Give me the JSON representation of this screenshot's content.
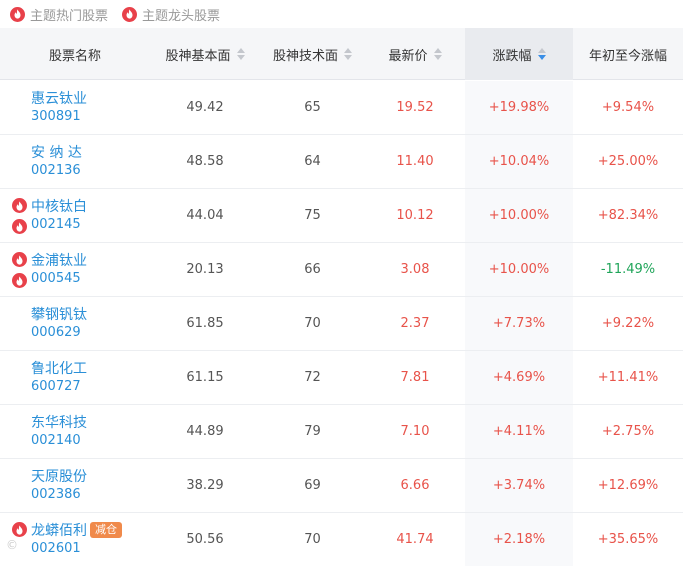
{
  "legend": [
    {
      "label": "主题热门股票"
    },
    {
      "label": "主题龙头股票"
    }
  ],
  "columns": {
    "name": "股票名称",
    "fundamental": "股神基本面",
    "technical": "股神技术面",
    "price": "最新价",
    "change": "涨跌幅",
    "ytd": "年初至今涨幅"
  },
  "sort": {
    "column": "change",
    "direction": "desc"
  },
  "rows": [
    {
      "name": "惠云钛业",
      "code": "300891",
      "fundamental": "49.42",
      "technical": "65",
      "price": "19.52",
      "change": "+19.98%",
      "ytd": "+9.54%",
      "badges": [],
      "tag": ""
    },
    {
      "name": "安 纳 达",
      "code": "002136",
      "fundamental": "48.58",
      "technical": "64",
      "price": "11.40",
      "change": "+10.04%",
      "ytd": "+25.00%",
      "badges": [],
      "tag": ""
    },
    {
      "name": "中核钛白",
      "code": "002145",
      "fundamental": "44.04",
      "technical": "75",
      "price": "10.12",
      "change": "+10.00%",
      "ytd": "+82.34%",
      "badges": [
        "hot",
        "leader"
      ],
      "tag": ""
    },
    {
      "name": "金浦钛业",
      "code": "000545",
      "fundamental": "20.13",
      "technical": "66",
      "price": "3.08",
      "change": "+10.00%",
      "ytd": "-11.49%",
      "badges": [
        "hot",
        "leader"
      ],
      "tag": ""
    },
    {
      "name": "攀钢钒钛",
      "code": "000629",
      "fundamental": "61.85",
      "technical": "70",
      "price": "2.37",
      "change": "+7.73%",
      "ytd": "+9.22%",
      "badges": [],
      "tag": ""
    },
    {
      "name": "鲁北化工",
      "code": "600727",
      "fundamental": "61.15",
      "technical": "72",
      "price": "7.81",
      "change": "+4.69%",
      "ytd": "+11.41%",
      "badges": [],
      "tag": ""
    },
    {
      "name": "东华科技",
      "code": "002140",
      "fundamental": "44.89",
      "technical": "79",
      "price": "7.10",
      "change": "+4.11%",
      "ytd": "+2.75%",
      "badges": [],
      "tag": ""
    },
    {
      "name": "天原股份",
      "code": "002386",
      "fundamental": "38.29",
      "technical": "69",
      "price": "6.66",
      "change": "+3.74%",
      "ytd": "+12.69%",
      "badges": [],
      "tag": ""
    },
    {
      "name": "龙蟒佰利",
      "code": "002601",
      "fundamental": "50.56",
      "technical": "70",
      "price": "41.74",
      "change": "+2.18%",
      "ytd": "+35.65%",
      "badges": [
        "hot"
      ],
      "tag": "减仓"
    }
  ],
  "colors": {
    "up": "#e8534a",
    "down": "#20a55a",
    "link": "#2a8fd7",
    "badge": "#e8414a",
    "tag": "#f08a4b"
  },
  "icons": {
    "hot": "fire-icon",
    "leader": "fire-icon"
  }
}
